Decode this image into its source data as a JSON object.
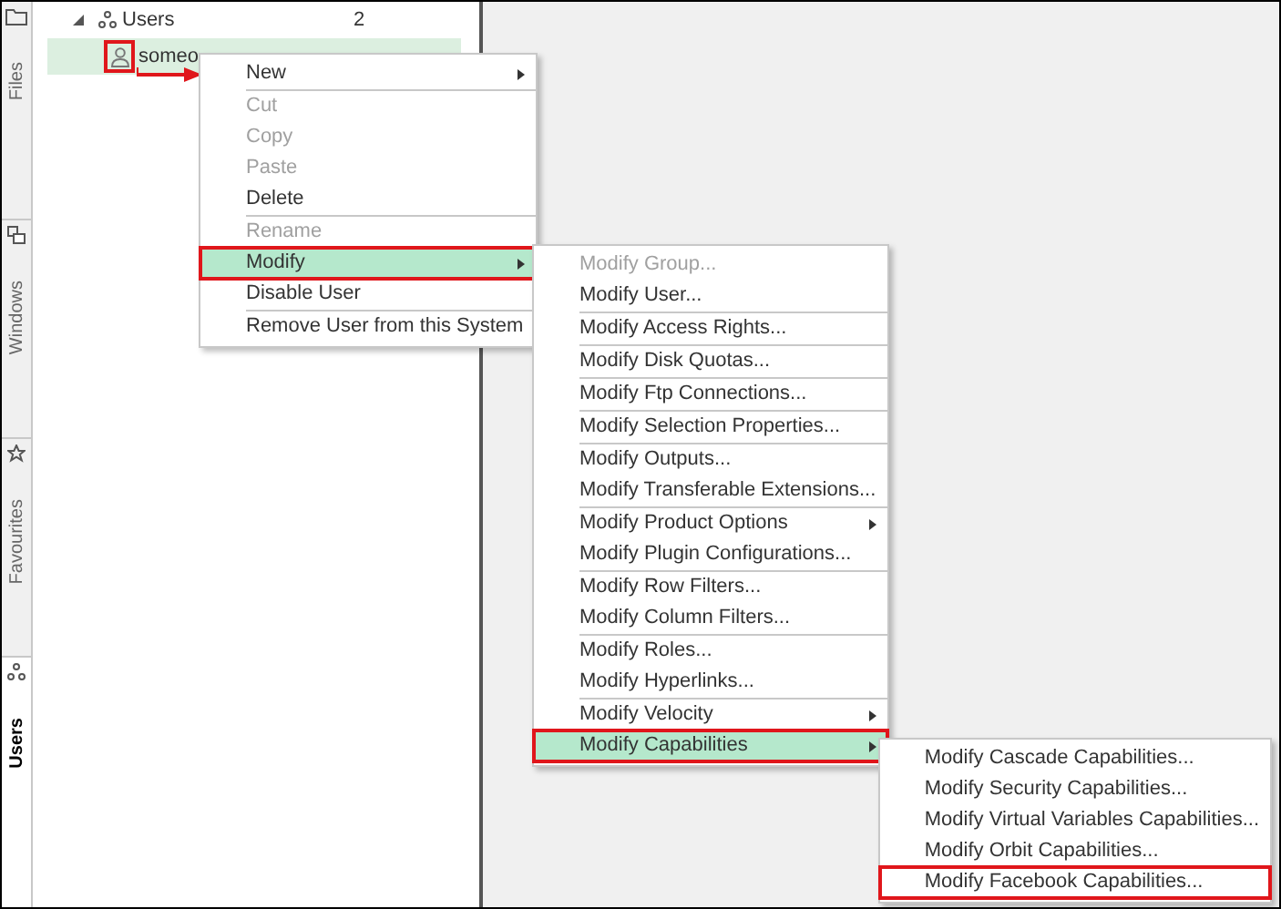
{
  "side_tabs": [
    {
      "label": "Files",
      "selected": false
    },
    {
      "label": "Windows",
      "selected": false
    },
    {
      "label": "Favourites",
      "selected": false
    },
    {
      "label": "Users",
      "selected": true
    }
  ],
  "tree": {
    "label": "Users",
    "count": "2",
    "expanded": true,
    "children": [
      {
        "label": "someo",
        "selected": true,
        "marked": true
      }
    ]
  },
  "context_menu": {
    "groups": [
      [
        {
          "label": "New",
          "disabled": false,
          "submenu": true,
          "selected": false,
          "marked": false
        }
      ],
      [
        {
          "label": "Cut",
          "disabled": true,
          "submenu": false,
          "selected": false,
          "marked": false
        },
        {
          "label": "Copy",
          "disabled": true,
          "submenu": false,
          "selected": false,
          "marked": false
        },
        {
          "label": "Paste",
          "disabled": true,
          "submenu": false,
          "selected": false,
          "marked": false
        },
        {
          "label": "Delete",
          "disabled": false,
          "submenu": false,
          "selected": false,
          "marked": false
        }
      ],
      [
        {
          "label": "Rename",
          "disabled": true,
          "submenu": false,
          "selected": false,
          "marked": false
        },
        {
          "label": "Modify",
          "disabled": false,
          "submenu": true,
          "selected": true,
          "marked": true
        },
        {
          "label": "Disable User",
          "disabled": false,
          "submenu": false,
          "selected": false,
          "marked": false
        }
      ],
      [
        {
          "label": "Remove User from this System",
          "disabled": false,
          "submenu": false,
          "selected": false,
          "marked": false
        }
      ]
    ]
  },
  "modify_menu": {
    "groups": [
      [
        {
          "label": "Modify Group...",
          "disabled": true,
          "submenu": false,
          "selected": false,
          "marked": false
        },
        {
          "label": "Modify User...",
          "disabled": false,
          "submenu": false,
          "selected": false,
          "marked": false
        }
      ],
      [
        {
          "label": "Modify Access Rights...",
          "disabled": false,
          "submenu": false,
          "selected": false,
          "marked": false
        }
      ],
      [
        {
          "label": "Modify Disk Quotas...",
          "disabled": false,
          "submenu": false,
          "selected": false,
          "marked": false
        }
      ],
      [
        {
          "label": "Modify Ftp Connections...",
          "disabled": false,
          "submenu": false,
          "selected": false,
          "marked": false
        }
      ],
      [
        {
          "label": "Modify Selection Properties...",
          "disabled": false,
          "submenu": false,
          "selected": false,
          "marked": false
        }
      ],
      [
        {
          "label": "Modify Outputs...",
          "disabled": false,
          "submenu": false,
          "selected": false,
          "marked": false
        },
        {
          "label": "Modify Transferable Extensions...",
          "disabled": false,
          "submenu": false,
          "selected": false,
          "marked": false
        }
      ],
      [
        {
          "label": "Modify Product Options",
          "disabled": false,
          "submenu": true,
          "selected": false,
          "marked": false
        },
        {
          "label": "Modify Plugin Configurations...",
          "disabled": false,
          "submenu": false,
          "selected": false,
          "marked": false
        }
      ],
      [
        {
          "label": "Modify Row Filters...",
          "disabled": false,
          "submenu": false,
          "selected": false,
          "marked": false
        },
        {
          "label": "Modify Column Filters...",
          "disabled": false,
          "submenu": false,
          "selected": false,
          "marked": false
        }
      ],
      [
        {
          "label": "Modify Roles...",
          "disabled": false,
          "submenu": false,
          "selected": false,
          "marked": false
        },
        {
          "label": "Modify Hyperlinks...",
          "disabled": false,
          "submenu": false,
          "selected": false,
          "marked": false
        }
      ],
      [
        {
          "label": "Modify Velocity",
          "disabled": false,
          "submenu": true,
          "selected": false,
          "marked": false
        },
        {
          "label": "Modify Capabilities",
          "disabled": false,
          "submenu": true,
          "selected": true,
          "marked": true
        }
      ]
    ]
  },
  "capabilities_menu": {
    "groups": [
      [
        {
          "label": "Modify Cascade Capabilities...",
          "disabled": false,
          "submenu": false,
          "selected": false,
          "marked": false
        },
        {
          "label": "Modify Security Capabilities...",
          "disabled": false,
          "submenu": false,
          "selected": false,
          "marked": false
        },
        {
          "label": "Modify Virtual Variables Capabilities...",
          "disabled": false,
          "submenu": false,
          "selected": false,
          "marked": false
        },
        {
          "label": "Modify Orbit Capabilities...",
          "disabled": false,
          "submenu": false,
          "selected": false,
          "marked": false
        },
        {
          "label": "Modify Facebook Capabilities...",
          "disabled": false,
          "submenu": false,
          "selected": false,
          "marked": true
        }
      ]
    ]
  }
}
